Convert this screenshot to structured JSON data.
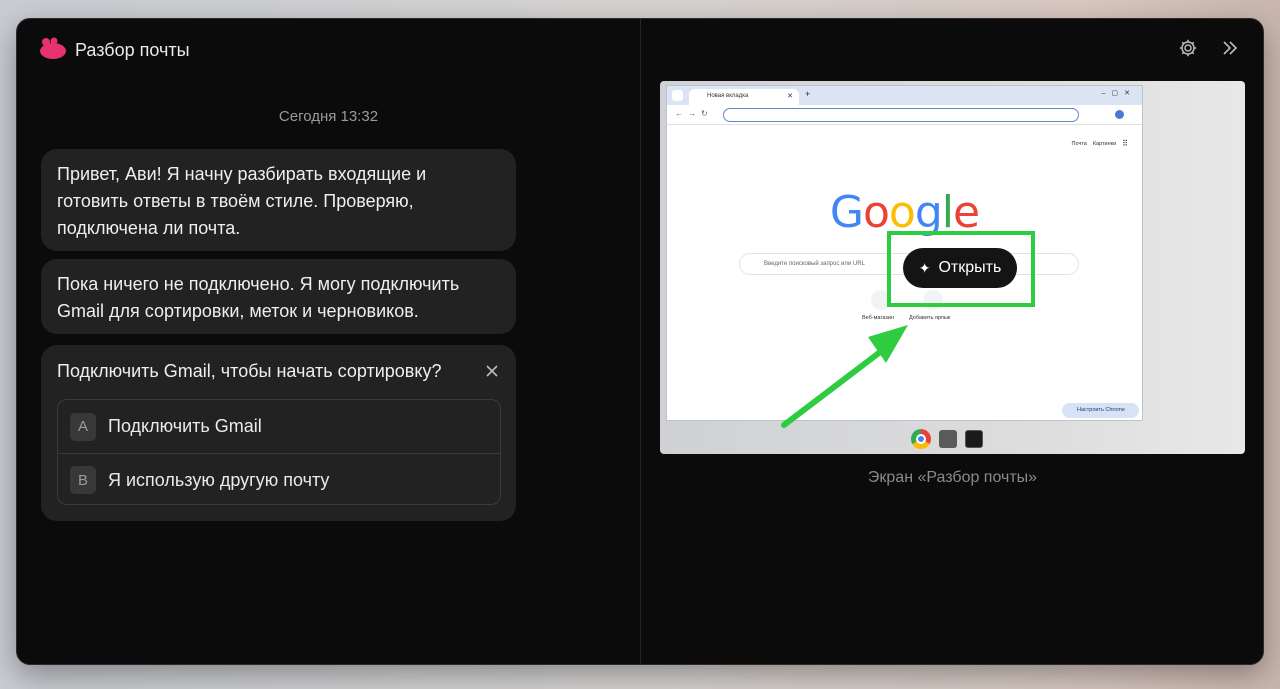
{
  "app": {
    "title": "Разбор почты"
  },
  "chat": {
    "timestamp": "Сегодня 13:32",
    "messages": [
      {
        "text": "Привет, Ави! Я начну разбирать входящие и готовить ответы в твоём стиле. Проверяю, подключена ли почта."
      },
      {
        "text": "Пока ничего не подключено. Я могу подключить Gmail для сортировки, меток и черновиков."
      }
    ],
    "question": {
      "text": "Подключить Gmail, чтобы начать сортировку?",
      "options": [
        {
          "key": "A",
          "label": "Подключить Gmail"
        },
        {
          "key": "B",
          "label": "Я использую другую почту"
        }
      ]
    }
  },
  "preview": {
    "caption": "Экран «Разбор почты»",
    "browser": {
      "tab_title": "Новая вкладка",
      "links": [
        "Почта",
        "Картинки"
      ],
      "logo": "Google",
      "search_placeholder": "Введите поисковый запрос или URL",
      "shortcuts": [
        "Веб-магазин",
        "Добавить ярлык"
      ],
      "customize_label": "Настроить Chrome"
    },
    "open_button": "Открыть"
  },
  "colors": {
    "highlight": "#2ecc40",
    "accent": "#e6336d",
    "background": "#0b0b0b"
  }
}
